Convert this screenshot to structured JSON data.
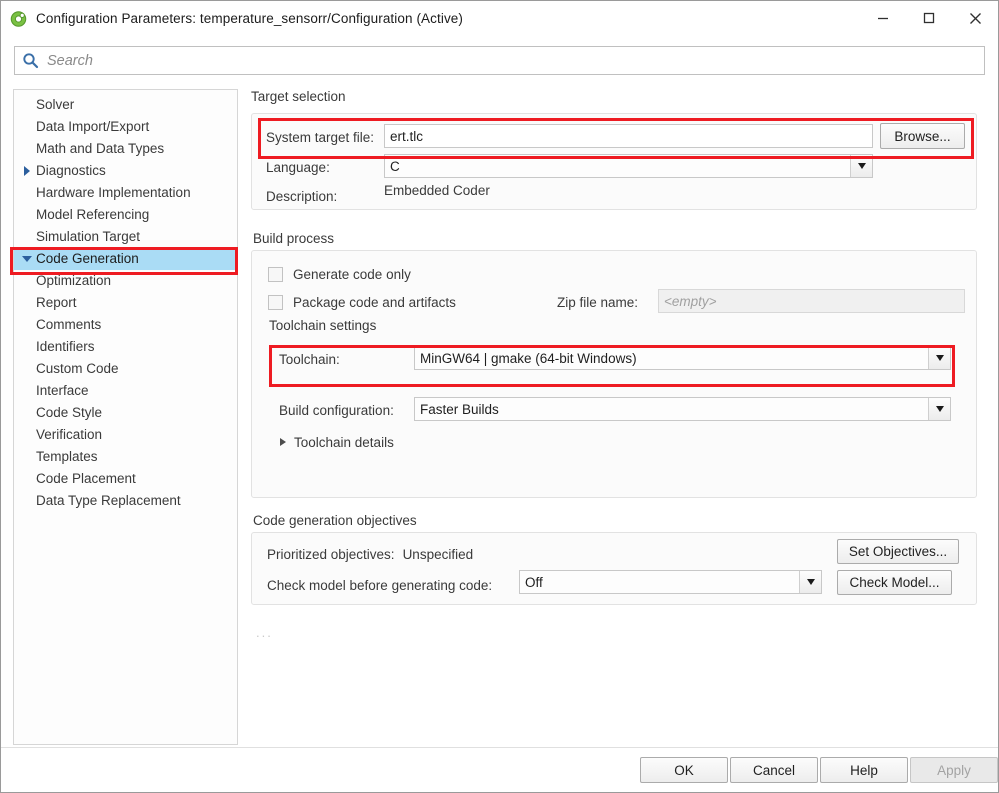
{
  "window": {
    "title": "Configuration Parameters: temperature_sensorr/Configuration (Active)",
    "app_icon": "simulink-icon",
    "minimize_label": "–",
    "maximize_label": "□",
    "close_label": "✕"
  },
  "search": {
    "placeholder": "Search",
    "value": "",
    "icon": "search-icon"
  },
  "sidebar": {
    "items": [
      {
        "label": "Solver",
        "level": 1,
        "arrow": "none",
        "selected": false
      },
      {
        "label": "Data Import/Export",
        "level": 1,
        "arrow": "none",
        "selected": false
      },
      {
        "label": "Math and Data Types",
        "level": 1,
        "arrow": "none",
        "selected": false
      },
      {
        "label": "Diagnostics",
        "level": 1,
        "arrow": "right",
        "selected": false
      },
      {
        "label": "Hardware Implementation",
        "level": 1,
        "arrow": "none",
        "selected": false
      },
      {
        "label": "Model Referencing",
        "level": 1,
        "arrow": "none",
        "selected": false
      },
      {
        "label": "Simulation Target",
        "level": 1,
        "arrow": "none",
        "selected": false
      },
      {
        "label": "Code Generation",
        "level": 1,
        "arrow": "down",
        "selected": true
      },
      {
        "label": "Optimization",
        "level": 2,
        "arrow": "none",
        "selected": false
      },
      {
        "label": "Report",
        "level": 2,
        "arrow": "none",
        "selected": false
      },
      {
        "label": "Comments",
        "level": 2,
        "arrow": "none",
        "selected": false
      },
      {
        "label": "Identifiers",
        "level": 2,
        "arrow": "none",
        "selected": false
      },
      {
        "label": "Custom Code",
        "level": 2,
        "arrow": "none",
        "selected": false
      },
      {
        "label": "Interface",
        "level": 2,
        "arrow": "none",
        "selected": false
      },
      {
        "label": "Code Style",
        "level": 2,
        "arrow": "none",
        "selected": false
      },
      {
        "label": "Verification",
        "level": 2,
        "arrow": "none",
        "selected": false
      },
      {
        "label": "Templates",
        "level": 2,
        "arrow": "none",
        "selected": false
      },
      {
        "label": "Code Placement",
        "level": 2,
        "arrow": "none",
        "selected": false
      },
      {
        "label": "Data Type Replacement",
        "level": 2,
        "arrow": "none",
        "selected": false
      }
    ]
  },
  "target_selection": {
    "group_title": "Target selection",
    "system_target_file_label": "System target file:",
    "system_target_file_value": "ert.tlc",
    "browse_label": "Browse...",
    "language_label": "Language:",
    "language_value": "C",
    "description_label": "Description:",
    "description_value": "Embedded Coder"
  },
  "build_process": {
    "group_title": "Build process",
    "generate_code_only_label": "Generate code only",
    "generate_code_only_checked": false,
    "package_code_label": "Package code and artifacts",
    "package_code_checked": false,
    "zip_file_name_label": "Zip file name:",
    "zip_file_name_value": "<empty>",
    "toolchain_settings_title": "Toolchain settings",
    "toolchain_label": "Toolchain:",
    "toolchain_value": "MinGW64 | gmake (64-bit Windows)",
    "build_configuration_label": "Build configuration:",
    "build_configuration_value": "Faster Builds",
    "toolchain_details_label": "Toolchain details"
  },
  "code_generation_objectives": {
    "group_title": "Code generation objectives",
    "prioritized_objectives_label": "Prioritized objectives:",
    "prioritized_objectives_value": "Unspecified",
    "set_objectives_label": "Set Objectives...",
    "check_model_label": "Check model before generating code:",
    "check_model_value": "Off",
    "check_model_button_label": "Check Model...",
    "overflow_label": "..."
  },
  "footer": {
    "ok_label": "OK",
    "cancel_label": "Cancel",
    "help_label": "Help",
    "apply_label": "Apply",
    "apply_disabled": true
  },
  "colors": {
    "annotation": "#EE1B22",
    "selection": "#AADCF5",
    "tree_arrow": "#2C5F9E",
    "search_icon": "#3A6FA8"
  }
}
